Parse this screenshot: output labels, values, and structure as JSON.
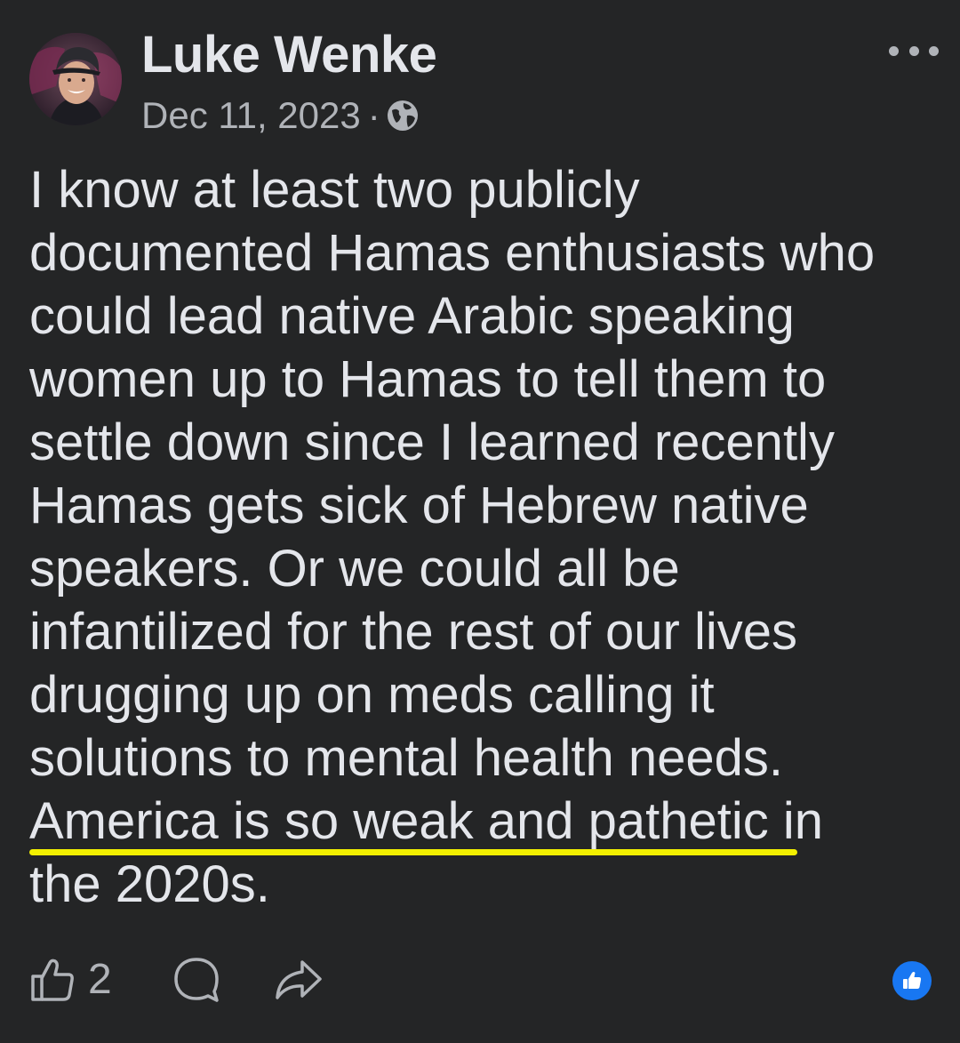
{
  "post": {
    "author": "Luke Wenke",
    "date": "Dec 11, 2023",
    "separator": "·",
    "privacy_icon": "globe-icon",
    "more_icon": "more-options-icon",
    "body_lines": [
      "I know at least two publicly",
      "documented Hamas enthusiasts who",
      "could lead native Arabic speaking",
      "women up to Hamas to tell them to",
      "settle down since I learned recently",
      "Hamas gets sick of Hebrew native",
      "speakers.  Or we could all be",
      "infantilized for the rest of our lives",
      "drugging up on meds calling it",
      "solutions to mental health needs.",
      "America is so weak and pathetic in",
      "the 2020s."
    ],
    "highlighted_phrase": "America is so weak and pathetic",
    "highlight_color": "#f3f000"
  },
  "actions": {
    "like_icon": "thumbs-up-icon",
    "like_count": "2",
    "comment_icon": "comment-icon",
    "share_icon": "share-icon",
    "reaction_icon": "like-reaction-icon",
    "reaction_color": "#1877f2"
  },
  "colors": {
    "background": "#242526",
    "primary_text": "#e4e6eb",
    "secondary_text": "#b0b3b8"
  }
}
